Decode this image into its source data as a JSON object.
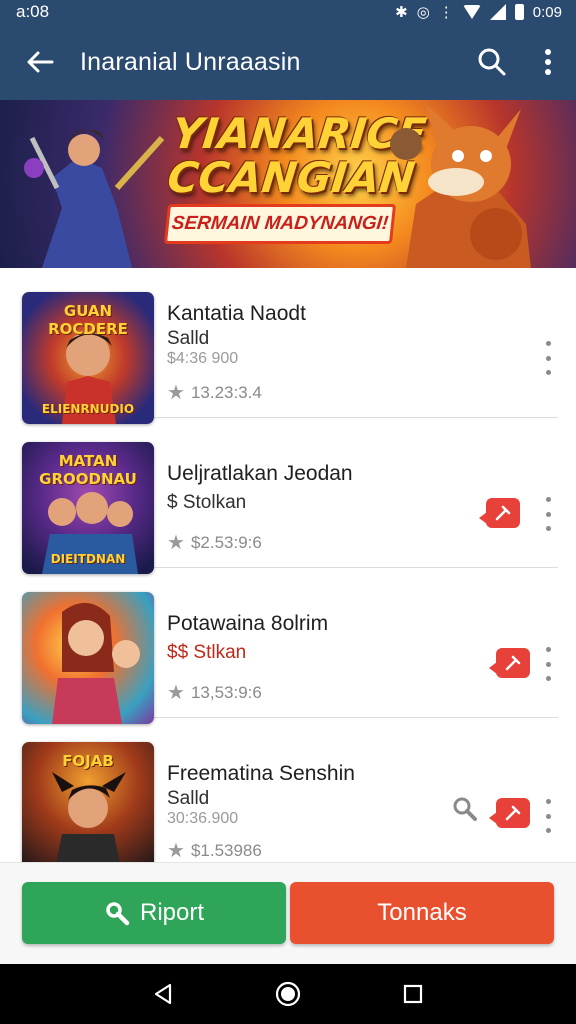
{
  "status_bar": {
    "time": "a:08",
    "right_time": "0:09"
  },
  "app_bar": {
    "title": "Inaranial Unraaasin"
  },
  "banner": {
    "headline_line1": "YIANARICE",
    "headline_line2": "CCANGIAN",
    "tagline": "SERMAIN MADYNANGI!"
  },
  "items": [
    {
      "thumb_title": "GUAN ROCDERE",
      "thumb_sub": "ELIENRNUDIO",
      "name": "Kantatia Naodt",
      "subtitle": "Salld",
      "price": "$4:36 900",
      "rating": "13.23:3.4"
    },
    {
      "thumb_title": "MATAN GROODNAU",
      "thumb_sub": "DIEITDNAN",
      "name": "Ueljratlakan Jeodan",
      "subtitle": "$ Stolkan",
      "price": "",
      "rating": "$2.53:9:6"
    },
    {
      "thumb_title": "",
      "thumb_sub": "",
      "name": "Potawaina 8olrim",
      "subtitle": "$$ Stlkan",
      "price": "",
      "rating": "13,53:9:6"
    },
    {
      "thumb_title": "FOJAB",
      "thumb_sub": "",
      "name": "Freematina Senshin",
      "subtitle": "Salld",
      "price": "30:36.900",
      "rating": "$1.53986"
    }
  ],
  "actions": {
    "report_label": "Riport",
    "tonnaks_label": "Tonnaks"
  },
  "colors": {
    "app_bar": "#2b4a70",
    "report": "#2ea558",
    "tonnaks": "#e8502e",
    "tag": "#e8413a"
  },
  "icons": [
    "back-arrow-icon",
    "search-icon",
    "more-vert-icon",
    "star-icon",
    "tag-icon",
    "wrench-icon",
    "nav-back-icon",
    "nav-home-icon",
    "nav-recents-icon"
  ]
}
